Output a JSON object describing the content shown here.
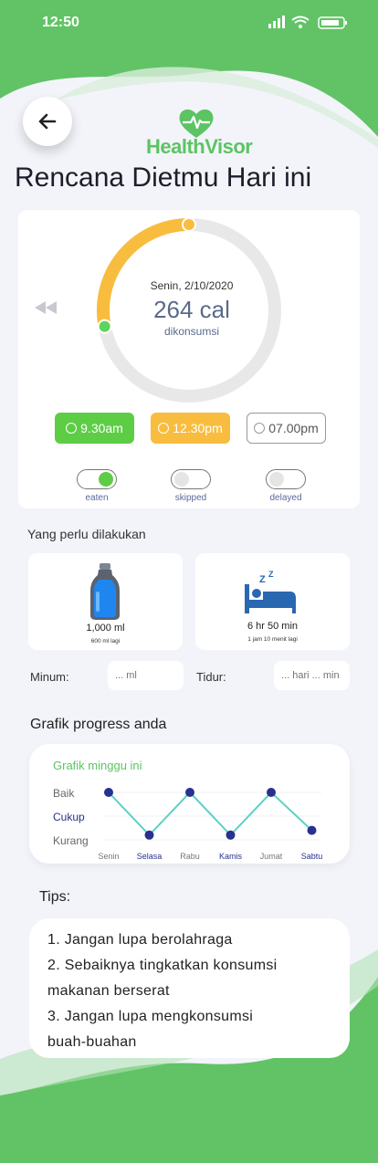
{
  "status_bar": {
    "time": "12:50"
  },
  "app": {
    "name": "HealthVisor"
  },
  "header": {
    "title": "Rencana Dietmu Hari ini"
  },
  "calorie_ring": {
    "date": "Senin, 2/10/2020",
    "calories": "264 cal",
    "label": "dikonsumsi",
    "progress_fraction": 0.28
  },
  "meal_times": [
    {
      "label": "9.30am",
      "state": "eaten",
      "color": "#5dcd45"
    },
    {
      "label": "12.30pm",
      "state": "current",
      "color": "#f8bd3e"
    },
    {
      "label": "07.00pm",
      "state": "upcoming",
      "color": "#ffffff"
    }
  ],
  "status_toggles": [
    {
      "label": "eaten",
      "on": true
    },
    {
      "label": "skipped",
      "on": false
    },
    {
      "label": "delayed",
      "on": false
    }
  ],
  "todo": {
    "section_title": "Yang perlu dilakukan",
    "drink": {
      "amount": "1,000 ml",
      "remaining": "600 ml lagi"
    },
    "sleep": {
      "amount": "6 hr 50 min",
      "remaining": "1 jam 10 menit lagi"
    }
  },
  "inputs": {
    "drink_label": "Minum:",
    "drink_placeholder": "... ml",
    "sleep_label": "Tidur:",
    "sleep_placeholder": "... hari ... min"
  },
  "progress": {
    "section_title": "Grafik progress anda",
    "chart_title": "Grafik minggu ini"
  },
  "chart_data": {
    "type": "line",
    "title": "Grafik minggu ini",
    "categories": [
      "Senin",
      "Selasa",
      "Rabu",
      "Kamis",
      "Jumat",
      "Sabtu"
    ],
    "y_levels": [
      "Kurang",
      "Cukup",
      "Baik"
    ],
    "values": [
      3,
      1.2,
      3,
      1.2,
      3,
      1.4
    ],
    "series_color": "#5ed0c4",
    "point_color": "#27318f"
  },
  "tips": {
    "title": "Tips:",
    "items": [
      "1. Jangan lupa berolahraga",
      "2. Sebaiknya tingkatkan konsumsi",
      "makanan berserat",
      "3. Jangan lupa mengkonsumsi",
      "buah-buahan"
    ]
  },
  "colors": {
    "brand_green": "#5cc463",
    "accent_yellow": "#f8bd3e",
    "ring_track": "#e8e8e8"
  }
}
